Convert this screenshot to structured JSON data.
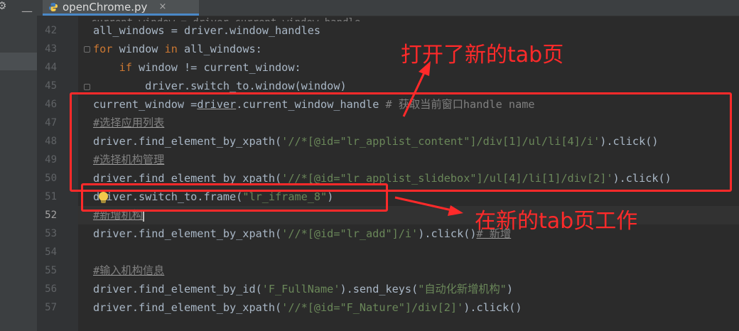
{
  "editor": {
    "tab_title": "openChrome.py",
    "tab_close": "×",
    "top_strip_dash": "—",
    "top_strip_gear": "⚙"
  },
  "line_numbers": [
    "42",
    "43",
    "44",
    "45",
    "46",
    "47",
    "48",
    "49",
    "50",
    "51",
    "52",
    "53",
    "54",
    "55",
    "56",
    "57"
  ],
  "code": {
    "l42": "all_windows = driver.window_handles",
    "l43_kw": "for",
    "l43_a": " window ",
    "l43_kw2": "in",
    "l43_b": " all_windows:",
    "l44_kw": "if",
    "l44_a": " window != current_window:",
    "l45": "driver.switch_to.window(window)",
    "l46_a": "current_window =",
    "l46_u": "driver",
    "l46_b": ".current_window_handle",
    "l46_c": " # 获取当前窗口handle name",
    "l47": "#选择应用列表",
    "l48_a": "driver.find_element_by_xpath(",
    "l48_s": "'//*[@id=\"lr_applist_content\"]/div[1]/ul/li[4]/i'",
    "l48_b": ").click()",
    "l49": "#选择机构管理",
    "l50_a": "driver.find_element_by_xpath(",
    "l50_s": "'//*[@id=\"lr_applist_slidebox\"]/ul[4]/li[1]/div[2]'",
    "l50_b": ").click()",
    "l51_a": "driver.switch_to.frame(",
    "l51_s": "\"lr_iframe_8\"",
    "l51_b": ")",
    "l52": "#新增机构",
    "l53_a": "driver.find_element_by_xpath(",
    "l53_s": "'//*[@id=\"lr_add\"]/i'",
    "l53_b": ").click()",
    "l53_c": "# 新增",
    "l55": "#输入机构信息",
    "l56_a": "driver.find_element_by_id(",
    "l56_s": "'F_FullName'",
    "l56_b": ").send_keys(",
    "l56_s2": "\"自动化新增机构\"",
    "l56_c": ")",
    "l57_a": "driver.find_element_by_xpath(",
    "l57_s": "'//*[@id=\"F_Nature\"]/div[2]'",
    "l57_b": ").click()"
  },
  "annotations": {
    "new_tab_opened": "打开了新的tab页",
    "work_in_new_tab": "在新的tab页工作"
  },
  "colors": {
    "annotation_red": "#ff2a2a",
    "keyword": "#cc7832",
    "string": "#6a8759",
    "comment": "#808080"
  }
}
